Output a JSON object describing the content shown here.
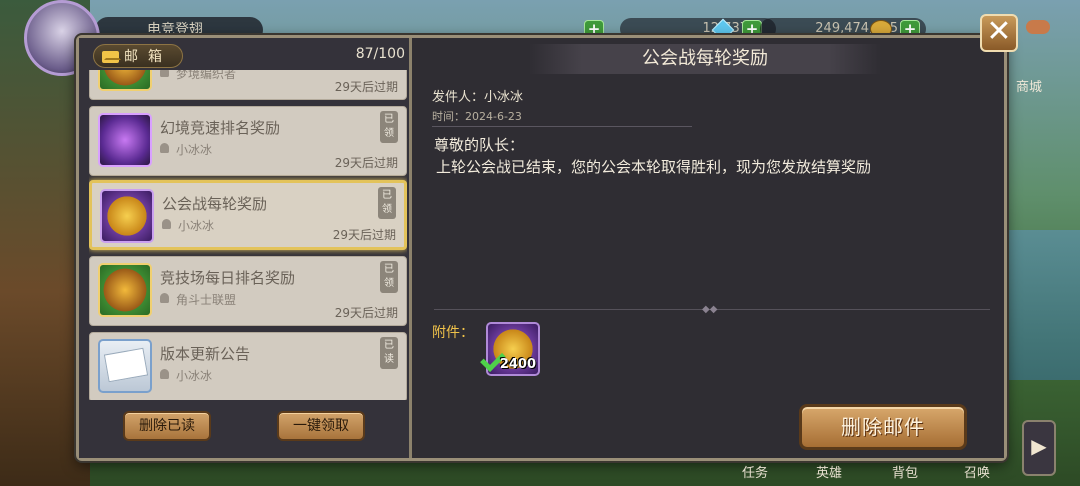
{
  "topbar": {
    "player_name": "电竞登翅",
    "resources": [
      {
        "value": "12,737",
        "icon": "gem-icon"
      },
      {
        "value": "249,474,605",
        "icon": "coin-icon"
      }
    ]
  },
  "inbox": {
    "title": "邮箱",
    "count": "87/100",
    "items": [
      {
        "title": "",
        "sender": "梦境编织者",
        "expiry": "29天后过期",
        "thumb": "gold-treasure-icon",
        "read": ""
      },
      {
        "title": "幻境竞速排名奖励",
        "sender": "小冰冰",
        "expiry": "29天后过期",
        "thumb": "purple-card-icon",
        "read": "已领"
      },
      {
        "title": "公会战每轮奖励",
        "sender": "小冰冰",
        "expiry": "29天后过期",
        "thumb": "guild-coin-icon",
        "read": "已领"
      },
      {
        "title": "竞技场每日排名奖励",
        "sender": "角斗士联盟",
        "expiry": "29天后过期",
        "thumb": "gold-treasure-icon",
        "read": "已领"
      },
      {
        "title": "版本更新公告",
        "sender": "小冰冰",
        "expiry": "",
        "thumb": "letter-icon",
        "read": "已读"
      }
    ],
    "delete_read_label": "删除已读",
    "claim_all_label": "一键领取"
  },
  "detail": {
    "title": "公会战每轮奖励",
    "from": "发件人：小冰冰",
    "time": "时间：2024-6-23",
    "greeting": "尊敬的队长：",
    "body": "上轮公会战已结束，您的公会本轮取得胜利，现为您发放结算奖励",
    "attachment_label": "附件：",
    "attachment_qty": "2400",
    "delete_label": "删除邮件"
  },
  "side": {
    "shop_label": "商城",
    "tabs": [
      "任务",
      "英雄",
      "背包",
      "召唤"
    ]
  },
  "colors": {
    "accent": "#e3c35a",
    "button": "#b07a40",
    "panel": "#2f2d33"
  }
}
